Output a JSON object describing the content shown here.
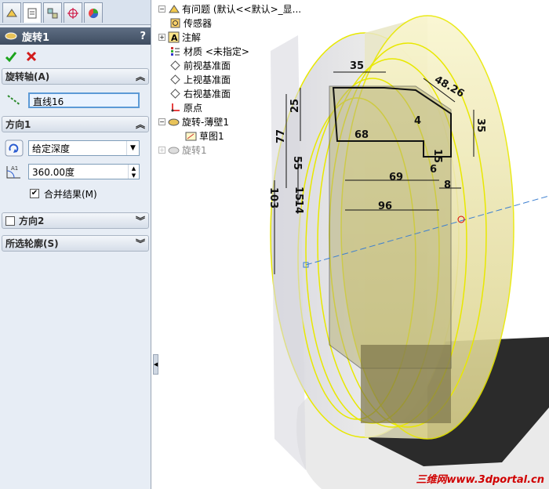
{
  "panel": {
    "title": "旋转1",
    "help": "?",
    "tabs": [
      "feature-manager-icon",
      "property-manager-icon",
      "configuration-manager-icon",
      "dimxpert-icon",
      "display-manager-icon"
    ]
  },
  "axis_section": {
    "label": "旋转轴(A)",
    "value": "直线16"
  },
  "dir1_section": {
    "label": "方向1",
    "type_value": "给定深度",
    "angle_value": "360.00度",
    "merge_label": "合并结果(M)",
    "merge_checked": true
  },
  "dir2_section": {
    "label": "方向2"
  },
  "contour_section": {
    "label": "所选轮廓(S)"
  },
  "tree": {
    "root": "有问题  (默认<<默认>_显...",
    "items": [
      "传感器",
      "注解",
      "材质 <未指定>",
      "前视基准面",
      "上视基准面",
      "右视基准面",
      "原点",
      "旋转-薄壁1",
      "草图1",
      "旋转1"
    ]
  },
  "dimensions": [
    "35",
    "48.26",
    "35",
    "25",
    "77",
    "4",
    "68",
    "15",
    "55",
    "6",
    "69",
    "103",
    "15",
    "14",
    "8",
    "96"
  ],
  "watermark": "三维网www.3dportal.cn",
  "colors": {
    "accent": "#e8e800",
    "title_bar": "#4a586c",
    "ok": "#1aa31a",
    "cancel": "#d21b1b"
  }
}
